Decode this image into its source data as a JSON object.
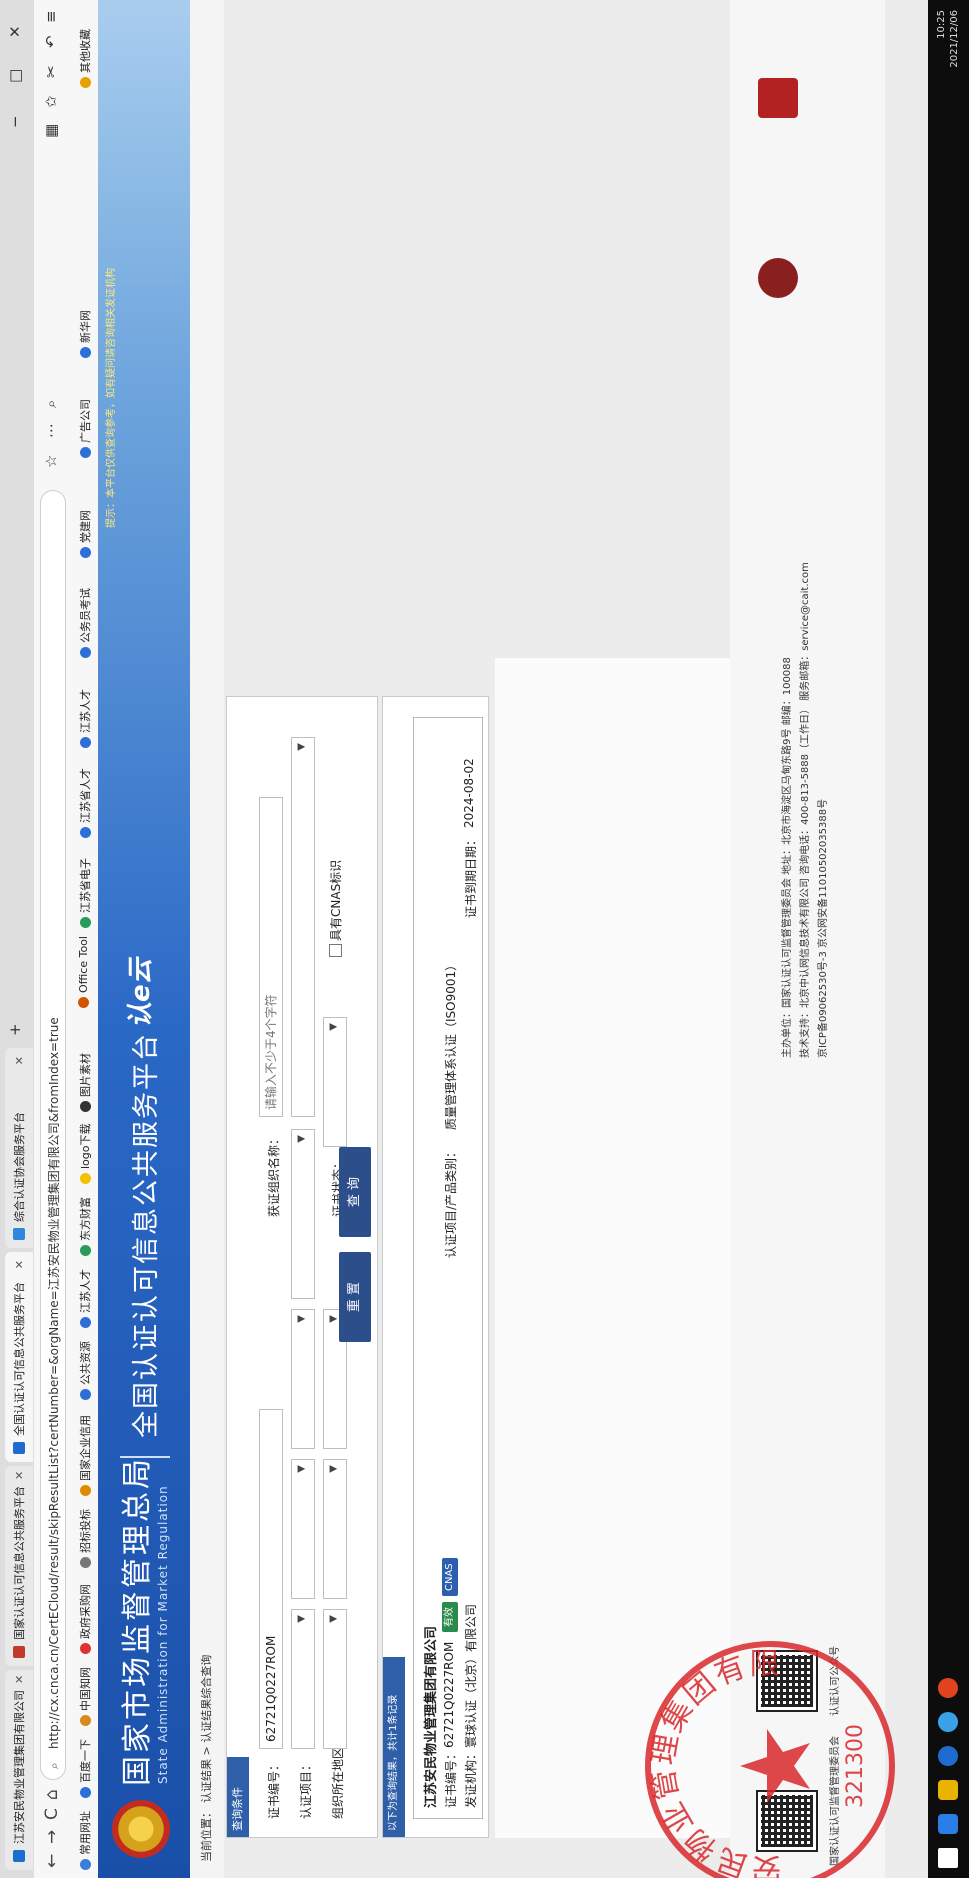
{
  "browser": {
    "tabs": [
      {
        "label": "江苏安民物业管理集团有限公司",
        "active": false,
        "color": "#1f6cd1"
      },
      {
        "label": "国家认证认可信息公共服务平台",
        "active": false,
        "color": "#c0392b"
      },
      {
        "label": "全国认证认可信息公共服务平台",
        "active": true,
        "color": "#1f6cd1"
      },
      {
        "label": "综合认证协会服务平台",
        "active": false,
        "color": "#2e86de"
      }
    ],
    "new_tab": "+",
    "url": "http://cx.cnca.cn/CertECloud/result/skipResultList?certNumber=&orgName=江苏安民物业管理集团有限公司&fromIndex=true",
    "bookmarks": [
      "常用网址",
      "百度一下",
      "中国知网",
      "政府采购网",
      "招标投标",
      "国家企业信用",
      "公共资源",
      "江苏人才",
      "东方财富",
      "logo下载",
      "图片素材",
      "Office Tool",
      "江苏省电子",
      "江苏省人才",
      "江苏人才",
      "公务员考试",
      "党建网",
      "广告公司",
      "新华网",
      "其他收藏"
    ],
    "nav_icons": {
      "back": "←",
      "forward": "→",
      "reload": "C",
      "home": "⌂"
    },
    "window_controls": [
      "−",
      "□",
      "✕"
    ]
  },
  "header": {
    "title": "国家市场监督管理总局",
    "subtitle_en": "State Administration for Market Regulation",
    "platform": "全国认证认可信息公共服务平台",
    "logo_text": "认e云",
    "notice": "提示：本平台仅供查询参考，如有疑问请咨询相关发证机构"
  },
  "breadcrumb": {
    "label": "当前位置：",
    "path": "认证结果 > 认证结果综合查询"
  },
  "search": {
    "section_label": "查询条件",
    "fields": {
      "cert_no_label": "证书编号：",
      "cert_no_value": "62721Q0227ROM",
      "org_name_label": "获证组织名称：",
      "org_name_placeholder": "请输入不少于4个字符",
      "project_label": "认证项目：",
      "region_label": "组织所在地区：",
      "status_label": "证书状态：",
      "cnas_label": "具有CNAS标识"
    },
    "reset_label": "重 置",
    "query_label": "查 询"
  },
  "results": {
    "section_label": "以下为查询结果，共计1条记录",
    "org_name": "江苏安民物业管理集团有限公司",
    "cert_no_label": "证书编号：",
    "cert_no": "62721Q0227ROM",
    "badge_valid": "有效",
    "badge_cnas": "CNAS",
    "issuer_label": "发证机构：",
    "issuer": "寰球认证（北京）有限公司",
    "project_label": "认证项目/产品类别：",
    "project": "质量管理体系认证（ISO9001）",
    "expiry_label": "证书到期日期：",
    "expiry": "2024-08-02"
  },
  "stamp": {
    "org": "江苏安民物业管理集团有限公司",
    "code": "321300"
  },
  "footer": {
    "qr1_caption": "国家认证认可监督管理委员会",
    "qr2_caption": "认证认可公众号",
    "line1": "主办单位：国家认证认可监督管理委员会  地址：北京市海淀区马甸东路9号  邮编：100088",
    "line2": "技术支持：北京中认网信息技术有限公司  咨询电话：400-813-5888（工作日）  服务邮箱：service@cait.com",
    "line3": "京ICP备09062530号-3  京公网安备11010502035388号"
  },
  "taskbar": {
    "time": "10:25",
    "date": "2021/12/06"
  }
}
